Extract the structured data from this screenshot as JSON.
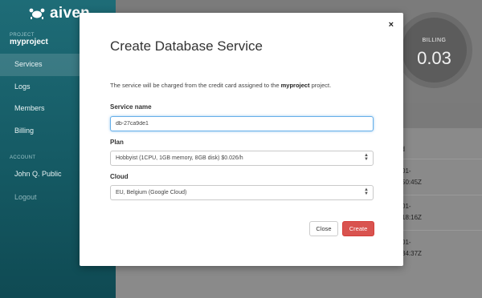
{
  "sidebar": {
    "brand": "aiven",
    "project_label": "PROJECT",
    "project_name": "myproject",
    "nav": [
      {
        "label": "Services"
      },
      {
        "label": "Logs"
      },
      {
        "label": "Members"
      },
      {
        "label": "Billing"
      }
    ],
    "account_label": "ACCOUNT",
    "account_user": "John Q. Public",
    "logout": "Logout"
  },
  "background": {
    "billing_label": "BILLING",
    "billing_amount": "0.03",
    "column_title": "ed",
    "rows": [
      {
        "line1": "01-",
        "line2": "50:45Z"
      },
      {
        "line1": "01-",
        "line2": "18:16Z"
      },
      {
        "line1": "01-",
        "line2": "34:37Z"
      }
    ]
  },
  "modal": {
    "close_symbol": "×",
    "title": "Create Database Service",
    "description_prefix": "The service will be charged from the credit card assigned to the",
    "description_project": "myproject",
    "description_suffix": "project.",
    "service_name_label": "Service name",
    "service_name_value": "db-27ca9de1",
    "plan_label": "Plan",
    "plan_value": "Hobbyist (1CPU, 1GB memory, 8GB disk) $0.026/h",
    "cloud_label": "Cloud",
    "cloud_value": "EU, Belgium (Google Cloud)",
    "close_button": "Close",
    "create_button": "Create"
  },
  "colors": {
    "sidebar": "#1e6c77",
    "create_button": "#d9534f",
    "focus_border": "#66afe9"
  }
}
